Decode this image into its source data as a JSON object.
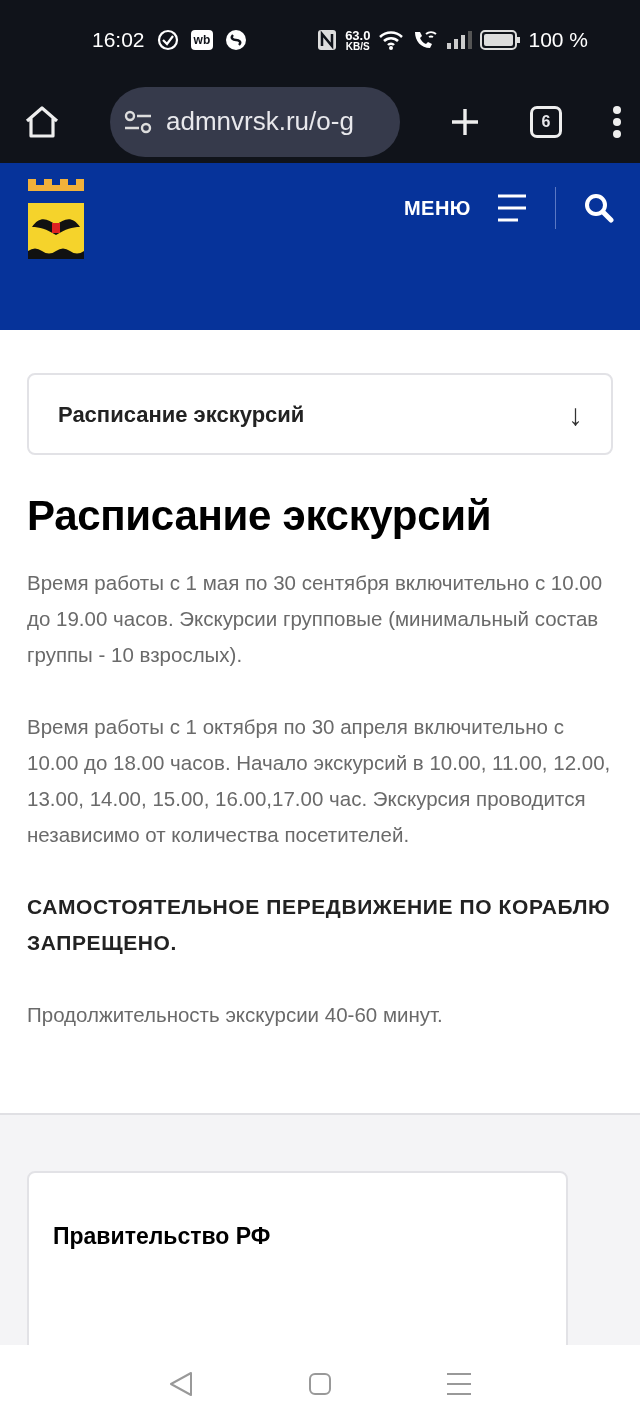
{
  "status_bar": {
    "time": "16:02",
    "app_badge": "wb",
    "speed_value": "63.0",
    "speed_unit": "KB/S",
    "battery": "100 %"
  },
  "browser": {
    "url": "admnvrsk.ru/o-g",
    "tab_count": "6"
  },
  "header": {
    "menu_label": "МЕНЮ"
  },
  "dropdown": {
    "label": "Расписание экскурсий",
    "arrow": "↓"
  },
  "title": "Расписание экскурсий",
  "paragraphs": [
    {
      "kind": "text",
      "text": "Время работы с 1 мая по 30 сентября включительно с 10.00 до 19.00 часов. Экскурсии групповые (минимальный состав группы - 10 взрослых)."
    },
    {
      "kind": "text",
      "text": "Время работы с 1 октября по 30 апреля включительно с 10.00 до 18.00 часов. Начало экскурсий в 10.00, 11.00, 12.00, 13.00, 14.00, 15.00, 16.00,17.00 час. Экскурсия проводится независимо от количества посетителей."
    },
    {
      "kind": "warning",
      "text": "САМОСТОЯТЕЛЬНОЕ ПЕРЕДВИЖЕНИЕ ПО КОРАБЛЮ ЗАПРЕЩЕНО."
    },
    {
      "kind": "text",
      "text": "Продолжительность экскурсии 40-60 минут."
    }
  ],
  "footer_card": {
    "title": "Правительство РФ"
  }
}
